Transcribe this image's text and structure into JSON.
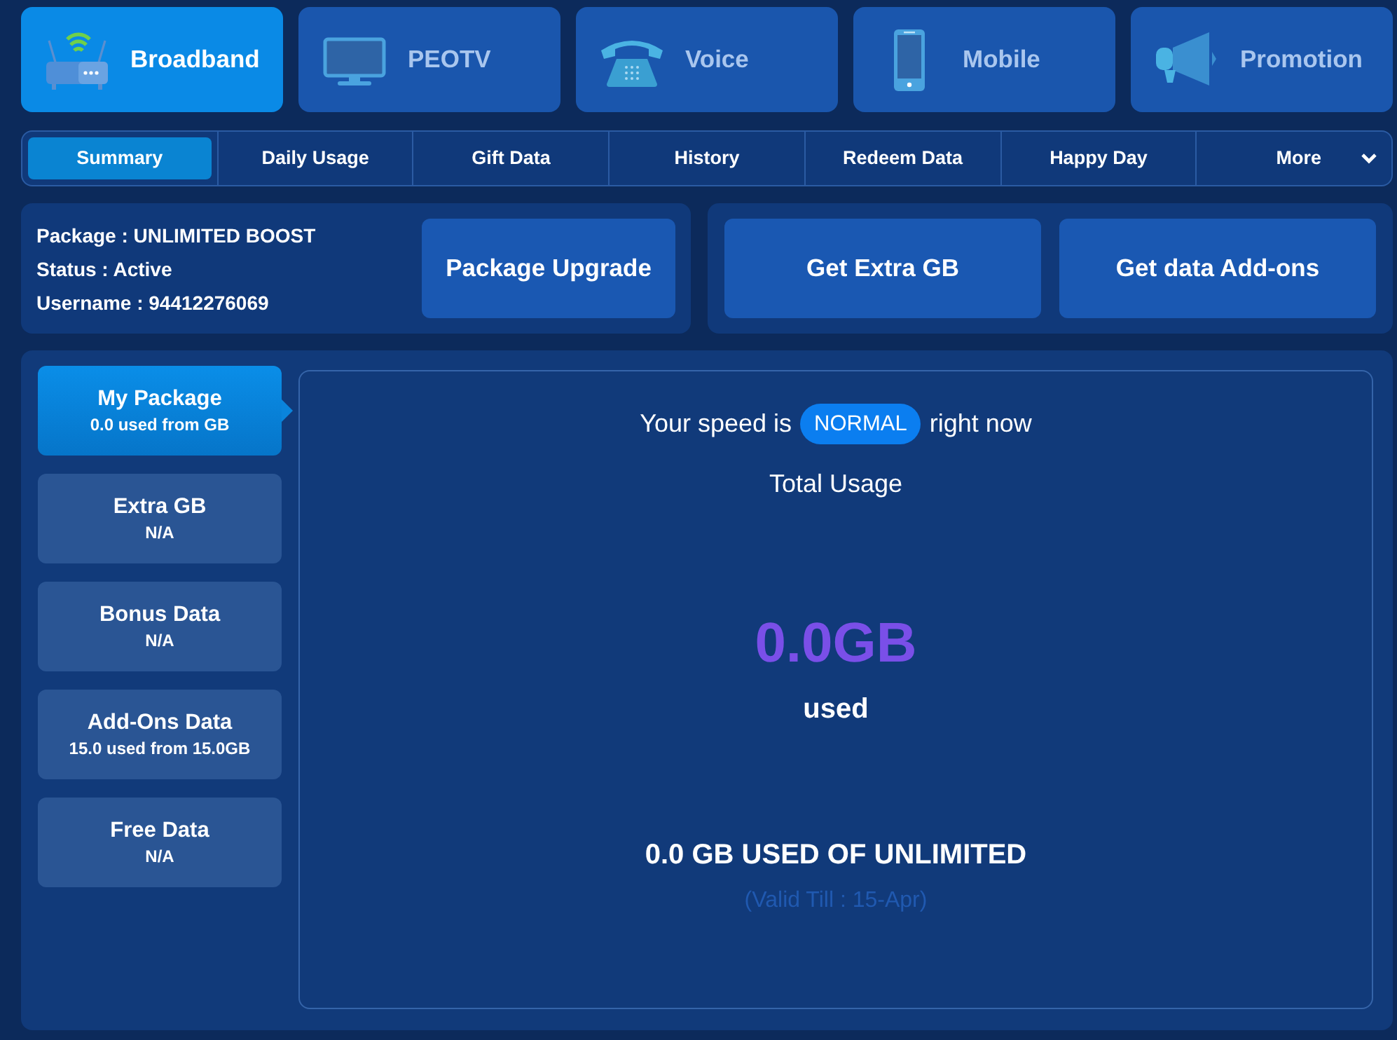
{
  "service_tabs": [
    {
      "label": "Broadband",
      "kind": "router",
      "selected": true
    },
    {
      "label": "PEOTV",
      "kind": "tv",
      "selected": false
    },
    {
      "label": "Voice",
      "kind": "telephone",
      "selected": false
    },
    {
      "label": "Mobile",
      "kind": "mobile",
      "selected": false
    },
    {
      "label": "Promotion",
      "kind": "megaphone",
      "selected": false
    }
  ],
  "sub_tabs": [
    {
      "label": "Summary",
      "kind": "tab",
      "selected": true
    },
    {
      "label": "Daily Usage",
      "kind": "tab",
      "selected": false
    },
    {
      "label": "Gift Data",
      "kind": "tab",
      "selected": false
    },
    {
      "label": "History",
      "kind": "tab",
      "selected": false
    },
    {
      "label": "Redeem Data",
      "kind": "tab",
      "selected": false
    },
    {
      "label": "Happy Day",
      "kind": "tab",
      "selected": false
    },
    {
      "label": "More",
      "kind": "dropdown",
      "selected": false
    }
  ],
  "account": {
    "lines": [
      "Package : UNLIMITED BOOST",
      "Status : Active",
      "Username : 94412276069"
    ],
    "upgrade_button": "Package Upgrade"
  },
  "actions": [
    "Get Extra GB",
    "Get data Add-ons"
  ],
  "data_buckets": [
    {
      "title": "My Package",
      "detail": "0.0 used from GB",
      "selected": true
    },
    {
      "title": "Extra GB",
      "detail": "N/A",
      "selected": false
    },
    {
      "title": "Bonus Data",
      "detail": "N/A",
      "selected": false
    },
    {
      "title": "Add-Ons Data",
      "detail": "15.0 used from 15.0GB",
      "selected": false
    },
    {
      "title": "Free Data",
      "detail": "N/A",
      "selected": false
    }
  ],
  "usage": {
    "speed_prefix": "Your speed is",
    "speed": "NORMAL",
    "speed_suffix": "right now",
    "heading": "Total Usage",
    "amount": "0.0GB",
    "amount_label": "used",
    "summary": "0.0 GB USED OF UNLIMITED",
    "valid_till": "(Valid Till : 15-Apr)"
  }
}
